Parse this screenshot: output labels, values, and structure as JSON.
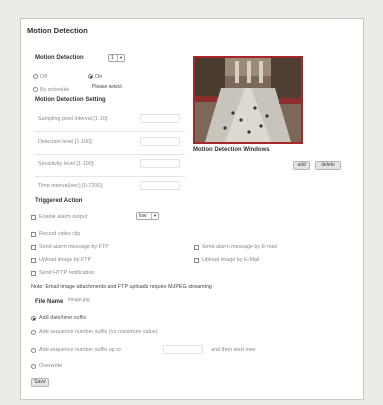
{
  "page": {
    "title": "Motion Detection"
  },
  "motion": {
    "label": "Motion Detection",
    "channel_value": "1",
    "off_label": "Off",
    "on_label": "On",
    "schedule_label": "By schedule",
    "schedule_select_placeholder": "Please select",
    "selected_mode": "On"
  },
  "setting": {
    "title": "Motion Detection Setting",
    "sampling_label": "Sampling pixel interval [1-10]:",
    "detection_label": "Detection level [1-100]:",
    "sensitivity_label": "Sensitivity level [1-100]:",
    "time_label": "Time interval(sec) [0-7200]:",
    "sampling_value": "",
    "detection_value": "",
    "sensitivity_value": "",
    "time_value": ""
  },
  "windows": {
    "label": "Motion Detection Windows",
    "add_label": "add",
    "delete_label": "delete"
  },
  "triggered": {
    "title": "Triggered Action",
    "enable_alarm_label": "Enable alarm output",
    "alarm_select_value": "low",
    "record_video_label": "Record video clip",
    "send_ftp_label": "Send alarm message by FTP",
    "send_email_label": "Send alarm message by E-mail",
    "upload_ftp_label": "Upload image by FTP",
    "upload_email_label": "Upload image by E-Mail",
    "send_http_label": "Send HTTP notification",
    "note": "Note: Email image attachments and FTP uploads require MJPEG streaming"
  },
  "file": {
    "label": "File Name",
    "placeholder": "image.jpg",
    "opt_datetime": "Add date/time suffix",
    "opt_sequence_nomax": "Add sequence number suffix (no maximum value)",
    "opt_sequence_upto_prefix": "Add sequence number suffix up to",
    "opt_sequence_upto_suffix": "and then start over",
    "opt_overwrite": "Overwrite",
    "upto_value": "",
    "selected": "Add date/time suffix"
  },
  "save_label": "Save",
  "colors": {
    "preview_border": "#a62828",
    "panel_bg": "#ffffff",
    "page_bg": "#ecece6"
  }
}
